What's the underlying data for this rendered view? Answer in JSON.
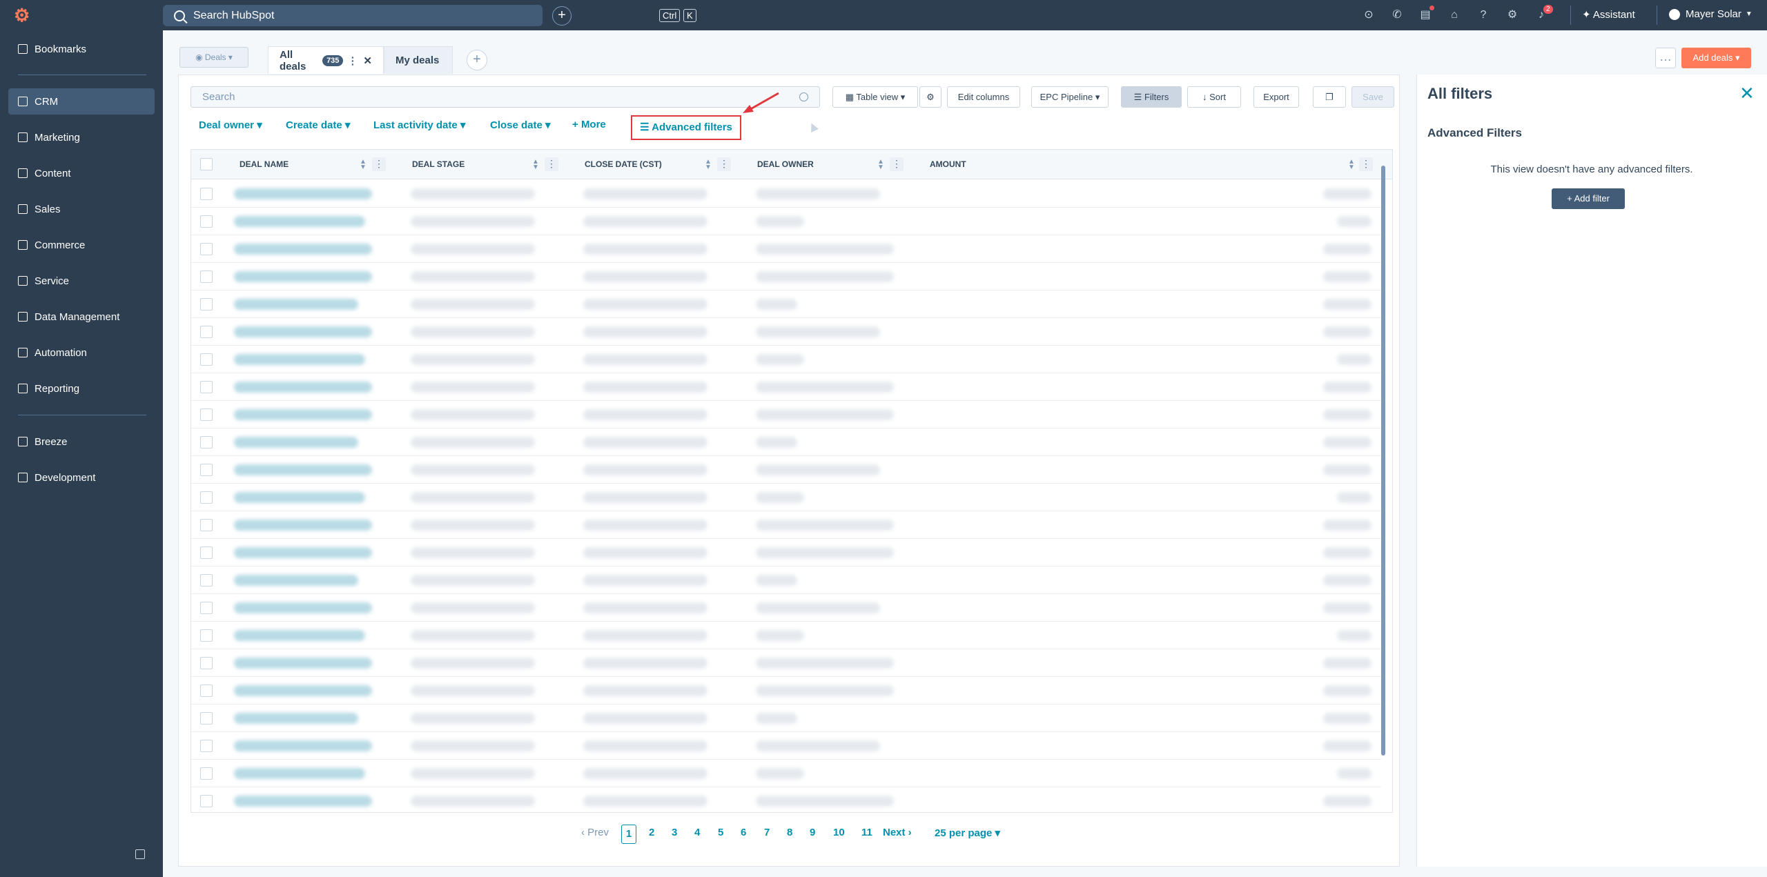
{
  "topbar": {
    "search_placeholder": "Search HubSpot",
    "kbd_ctrl": "Ctrl",
    "kbd_k": "K",
    "notification_count": "2",
    "assistant_label": "Assistant",
    "account_name": "Mayer Solar"
  },
  "sidebar": {
    "items": [
      {
        "label": "Bookmarks"
      },
      {
        "label": "CRM"
      },
      {
        "label": "Marketing"
      },
      {
        "label": "Content"
      },
      {
        "label": "Sales"
      },
      {
        "label": "Commerce"
      },
      {
        "label": "Service"
      },
      {
        "label": "Data Management"
      },
      {
        "label": "Automation"
      },
      {
        "label": "Reporting"
      },
      {
        "label": "Breeze"
      },
      {
        "label": "Development"
      }
    ]
  },
  "header": {
    "object_selector": "Deals",
    "tabs": [
      {
        "label": "All deals",
        "count": "735"
      },
      {
        "label": "My deals"
      }
    ],
    "add_deals_label": "Add deals"
  },
  "toolbar": {
    "search_placeholder": "Search",
    "table_view_label": "Table view",
    "edit_columns_label": "Edit columns",
    "pipeline_label": "EPC Pipeline",
    "filters_label": "Filters",
    "sort_label": "Sort",
    "export_label": "Export",
    "save_label": "Save"
  },
  "quick_filters": {
    "deal_owner": "Deal owner",
    "create_date": "Create date",
    "last_activity_date": "Last activity date",
    "close_date": "Close date",
    "more": "More",
    "advanced_filters": "Advanced filters"
  },
  "table": {
    "columns": [
      "DEAL NAME",
      "DEAL STAGE",
      "CLOSE DATE (CST)",
      "DEAL OWNER",
      "AMOUNT"
    ]
  },
  "pagination": {
    "prev": "Prev",
    "pages": [
      "1",
      "2",
      "3",
      "4",
      "5",
      "6",
      "7",
      "8",
      "9",
      "10",
      "11"
    ],
    "next": "Next",
    "per_page": "25 per page"
  },
  "filters_panel": {
    "title": "All filters",
    "section_title": "Advanced Filters",
    "empty_message": "This view doesn't have any advanced filters.",
    "add_filter_label": "Add filter"
  },
  "colors": {
    "nav_bg": "#2d3e50",
    "accent_orange": "#ff7a59",
    "link_teal": "#0091ae",
    "highlight_red": "#e0383e"
  }
}
